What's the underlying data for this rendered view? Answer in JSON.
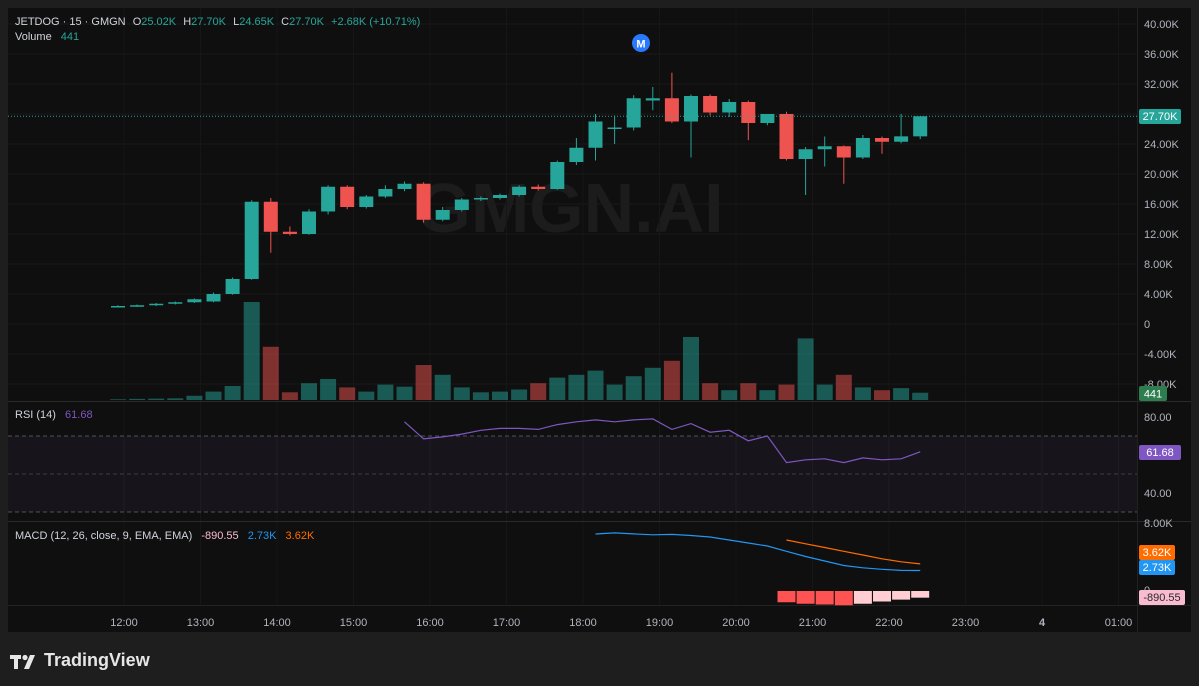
{
  "legend": {
    "symbol": "JETDOG · 15 · GMGN",
    "o_label": "O",
    "o_value": "25.02K",
    "h_label": "H",
    "h_value": "27.70K",
    "l_label": "L",
    "l_value": "24.65K",
    "c_label": "C",
    "c_value": "27.70K",
    "change": "+2.68K (+10.71%)",
    "volume_label": "Volume",
    "volume_value": "441"
  },
  "watermark": "GMGN.AI",
  "marker": "M",
  "rsi": {
    "label": "RSI (14)",
    "value": "61.68",
    "ticks": [
      "80.00",
      "40.00"
    ],
    "upper": 70,
    "lower": 30
  },
  "macd": {
    "label": "MACD (12, 26, close, 9, EMA, EMA)",
    "hist_value": "-890.55",
    "macd_value": "2.73K",
    "signal_value": "3.62K",
    "ticks": [
      "8.00K",
      "0"
    ]
  },
  "price_axis": [
    "40.00K",
    "36.00K",
    "32.00K",
    "28.00K",
    "24.00K",
    "20.00K",
    "16.00K",
    "12.00K",
    "8.00K",
    "4.00K",
    "0",
    "-4.00K",
    "-8.00K"
  ],
  "price_badge": "27.70K",
  "volume_badge": "441",
  "time_axis": [
    "12:00",
    "13:00",
    "14:00",
    "15:00",
    "16:00",
    "17:00",
    "18:00",
    "19:00",
    "20:00",
    "21:00",
    "22:00",
    "23:00",
    "4",
    "01:00"
  ],
  "brand": "TradingView",
  "colors": {
    "up": "#26a69a",
    "down": "#ef5350",
    "rsi": "#7e57c2",
    "macd": "#2196f3",
    "signal": "#ff6d00",
    "bg": "#0f0f0f"
  },
  "chart_data": {
    "type": "candlestick",
    "interval": "15",
    "candles": [
      {
        "t": "11:45",
        "o": 2.3,
        "h": 2.5,
        "l": 2.2,
        "c": 2.4
      },
      {
        "t": "12:00",
        "o": 2.4,
        "h": 2.6,
        "l": 2.3,
        "c": 2.5
      },
      {
        "t": "12:15",
        "o": 2.5,
        "h": 2.8,
        "l": 2.4,
        "c": 2.7
      },
      {
        "t": "12:30",
        "o": 2.7,
        "h": 3.0,
        "l": 2.6,
        "c": 2.9
      },
      {
        "t": "12:45",
        "o": 2.9,
        "h": 3.4,
        "l": 2.8,
        "c": 3.3
      },
      {
        "t": "13:00",
        "o": 3.0,
        "h": 4.2,
        "l": 2.9,
        "c": 4.0
      },
      {
        "t": "13:15",
        "o": 4.0,
        "h": 6.2,
        "l": 3.9,
        "c": 6.0
      },
      {
        "t": "13:30",
        "o": 6.0,
        "h": 16.5,
        "l": 5.9,
        "c": 16.3
      },
      {
        "t": "13:45",
        "o": 16.3,
        "h": 16.8,
        "l": 9.5,
        "c": 12.3
      },
      {
        "t": "14:00",
        "o": 12.3,
        "h": 13.0,
        "l": 11.8,
        "c": 12.0
      },
      {
        "t": "14:15",
        "o": 12.0,
        "h": 15.3,
        "l": 11.9,
        "c": 15.0
      },
      {
        "t": "14:30",
        "o": 15.0,
        "h": 18.5,
        "l": 14.6,
        "c": 18.3
      },
      {
        "t": "14:45",
        "o": 18.3,
        "h": 18.5,
        "l": 15.3,
        "c": 15.6
      },
      {
        "t": "15:00",
        "o": 15.6,
        "h": 17.2,
        "l": 15.4,
        "c": 17.0
      },
      {
        "t": "15:15",
        "o": 17.0,
        "h": 18.5,
        "l": 16.8,
        "c": 18.0
      },
      {
        "t": "15:30",
        "o": 18.0,
        "h": 19.0,
        "l": 17.7,
        "c": 18.7
      },
      {
        "t": "15:45",
        "o": 18.7,
        "h": 18.9,
        "l": 13.5,
        "c": 13.9
      },
      {
        "t": "16:00",
        "o": 13.9,
        "h": 15.6,
        "l": 13.7,
        "c": 15.2
      },
      {
        "t": "16:15",
        "o": 15.2,
        "h": 16.8,
        "l": 15.0,
        "c": 16.6
      },
      {
        "t": "16:30",
        "o": 16.6,
        "h": 17.0,
        "l": 16.4,
        "c": 16.8
      },
      {
        "t": "16:45",
        "o": 16.8,
        "h": 17.4,
        "l": 16.6,
        "c": 17.2
      },
      {
        "t": "17:00",
        "o": 17.2,
        "h": 18.5,
        "l": 17.0,
        "c": 18.3
      },
      {
        "t": "17:15",
        "o": 18.3,
        "h": 18.6,
        "l": 17.8,
        "c": 18.0
      },
      {
        "t": "17:30",
        "o": 18.0,
        "h": 21.8,
        "l": 17.9,
        "c": 21.6
      },
      {
        "t": "17:45",
        "o": 21.6,
        "h": 24.8,
        "l": 21.2,
        "c": 23.5
      },
      {
        "t": "18:00",
        "o": 23.5,
        "h": 28.0,
        "l": 21.8,
        "c": 27.0
      },
      {
        "t": "18:15",
        "o": 26.0,
        "h": 27.8,
        "l": 24.0,
        "c": 26.2
      },
      {
        "t": "18:30",
        "o": 26.2,
        "h": 30.5,
        "l": 25.8,
        "c": 30.1
      },
      {
        "t": "18:45",
        "o": 29.8,
        "h": 31.6,
        "l": 28.5,
        "c": 30.1
      },
      {
        "t": "19:00",
        "o": 30.1,
        "h": 33.5,
        "l": 26.8,
        "c": 27.0
      },
      {
        "t": "19:15",
        "o": 27.0,
        "h": 30.6,
        "l": 22.2,
        "c": 30.4
      },
      {
        "t": "19:30",
        "o": 30.4,
        "h": 30.6,
        "l": 27.8,
        "c": 28.2
      },
      {
        "t": "19:45",
        "o": 28.2,
        "h": 30.0,
        "l": 27.6,
        "c": 29.6
      },
      {
        "t": "20:00",
        "o": 29.6,
        "h": 29.8,
        "l": 24.5,
        "c": 26.8
      },
      {
        "t": "20:15",
        "o": 26.8,
        "h": 28.0,
        "l": 26.5,
        "c": 28.0
      },
      {
        "t": "20:30",
        "o": 28.0,
        "h": 28.3,
        "l": 21.8,
        "c": 22.0
      },
      {
        "t": "20:45",
        "o": 22.0,
        "h": 23.6,
        "l": 17.2,
        "c": 23.3
      },
      {
        "t": "21:00",
        "o": 23.3,
        "h": 25.0,
        "l": 21.0,
        "c": 23.7
      },
      {
        "t": "21:15",
        "o": 23.7,
        "h": 23.8,
        "l": 18.7,
        "c": 22.2
      },
      {
        "t": "21:30",
        "o": 22.2,
        "h": 25.2,
        "l": 22.0,
        "c": 24.8
      },
      {
        "t": "21:45",
        "o": 24.8,
        "h": 25.0,
        "l": 22.7,
        "c": 24.3
      },
      {
        "t": "22:00",
        "o": 24.3,
        "h": 28.0,
        "l": 24.1,
        "c": 25.02
      },
      {
        "t": "22:15",
        "o": 25.02,
        "h": 27.7,
        "l": 24.65,
        "c": 27.7
      }
    ],
    "volume": [
      5,
      8,
      10,
      12,
      30,
      60,
      100,
      700,
      380,
      55,
      120,
      150,
      90,
      60,
      110,
      95,
      250,
      180,
      90,
      55,
      60,
      75,
      120,
      160,
      180,
      210,
      110,
      170,
      230,
      280,
      450,
      120,
      70,
      120,
      70,
      110,
      440,
      110,
      180,
      90,
      70,
      85,
      52
    ],
    "rsi": [
      null,
      null,
      null,
      null,
      null,
      null,
      null,
      null,
      null,
      null,
      null,
      null,
      null,
      null,
      null,
      77.5,
      68.5,
      69.5,
      71,
      73,
      74,
      74,
      73.5,
      76,
      77.5,
      78.5,
      77.5,
      78.5,
      79,
      73.5,
      76.5,
      72,
      73,
      67.5,
      70,
      56,
      57.5,
      58,
      56,
      58.5,
      57.5,
      58,
      61.68
    ],
    "macd_line": [
      null,
      null,
      null,
      null,
      null,
      null,
      null,
      null,
      null,
      null,
      null,
      null,
      null,
      null,
      null,
      null,
      null,
      null,
      null,
      null,
      null,
      null,
      null,
      null,
      null,
      7600,
      7750,
      7620,
      7500,
      7550,
      7400,
      7200,
      6800,
      6400,
      6000,
      5300,
      4600,
      4000,
      3400,
      3100,
      2900,
      2750,
      2730
    ],
    "signal_line": [
      null,
      null,
      null,
      null,
      null,
      null,
      null,
      null,
      null,
      null,
      null,
      null,
      null,
      null,
      null,
      null,
      null,
      null,
      null,
      null,
      null,
      null,
      null,
      null,
      null,
      null,
      null,
      null,
      null,
      null,
      null,
      null,
      null,
      null,
      null,
      6800,
      6300,
      5800,
      5300,
      4800,
      4300,
      3900,
      3620
    ],
    "macd_hist": [
      null,
      null,
      null,
      null,
      null,
      null,
      null,
      null,
      null,
      null,
      null,
      null,
      null,
      null,
      null,
      null,
      null,
      null,
      null,
      null,
      null,
      null,
      null,
      null,
      null,
      null,
      null,
      null,
      null,
      null,
      null,
      null,
      null,
      null,
      null,
      -1500,
      -1700,
      -1800,
      -1900,
      -1700,
      -1400,
      -1150,
      -890.55
    ],
    "ylim": [
      -8000,
      40000
    ]
  }
}
